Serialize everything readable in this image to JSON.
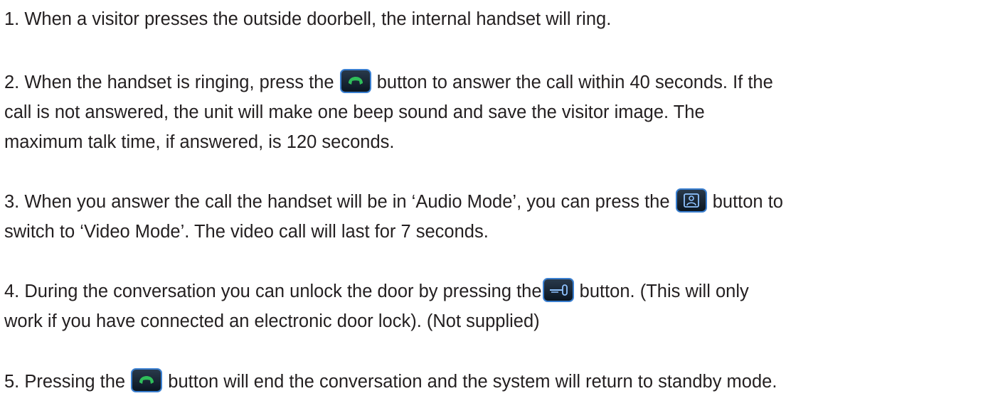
{
  "steps": [
    {
      "id": 1,
      "lines": [
        "1. When a visitor presses the outside doorbell, the internal handset will ring."
      ]
    },
    {
      "id": 2,
      "line1_before": "2. When the handset is ringing, press the",
      "line1_after": "button to answer the call within 40 seconds. If the",
      "line2": "call is not answered, the unit will make one beep sound and save the visitor image. The",
      "line3": "maximum talk time, if answered, is 120 seconds.",
      "icon": "phone-handset-icon"
    },
    {
      "id": 3,
      "line1_before": "3. When you answer the call the handset will be in ‘Audio Mode’, you can press the",
      "line1_after": "button to",
      "line2": "switch to ‘Video Mode’. The video call will last for 7 seconds.",
      "icon": "person-monitor-icon"
    },
    {
      "id": 4,
      "line1_before": "4. During the conversation you can unlock the door by pressing the",
      "line1_after": "button. (This will only",
      "line2": "work if you have connected an electronic door lock). (Not supplied)",
      "icon": "key-icon"
    },
    {
      "id": 5,
      "line1_before": "5. Pressing the",
      "line1_after": "button will end the conversation and the system will return to standby mode.",
      "icon": "phone-handset-icon"
    }
  ],
  "colors": {
    "text": "#231f20",
    "icon_frame": "#3a7fd0",
    "icon_bg": "#0c1c2e",
    "handset_green": "#2fbf5a",
    "icon_glyph_blue": "#8fc3ff"
  }
}
